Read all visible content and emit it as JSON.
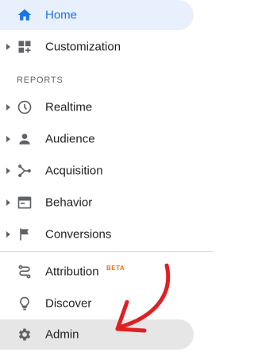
{
  "nav": {
    "home": {
      "label": "Home",
      "icon": "home-icon",
      "active": true
    },
    "customization": {
      "label": "Customization",
      "icon": "dashboard-plus-icon"
    },
    "section_header": "REPORTS",
    "realtime": {
      "label": "Realtime",
      "icon": "clock-icon"
    },
    "audience": {
      "label": "Audience",
      "icon": "person-icon"
    },
    "acquisition": {
      "label": "Acquisition",
      "icon": "acquisition-branch-icon"
    },
    "behavior": {
      "label": "Behavior",
      "icon": "browser-window-icon"
    },
    "conversions": {
      "label": "Conversions",
      "icon": "flag-icon"
    },
    "attribution": {
      "label": "Attribution",
      "badge": "BETA",
      "icon": "attribution-path-icon"
    },
    "discover": {
      "label": "Discover",
      "icon": "lightbulb-icon"
    },
    "admin": {
      "label": "Admin",
      "icon": "gear-icon"
    }
  },
  "colors": {
    "active_text": "#1a73e8",
    "active_bg": "#e8f0fe",
    "icon": "#5f6368",
    "beta_badge": "#e8710a",
    "annotation_arrow": "#e02020"
  }
}
